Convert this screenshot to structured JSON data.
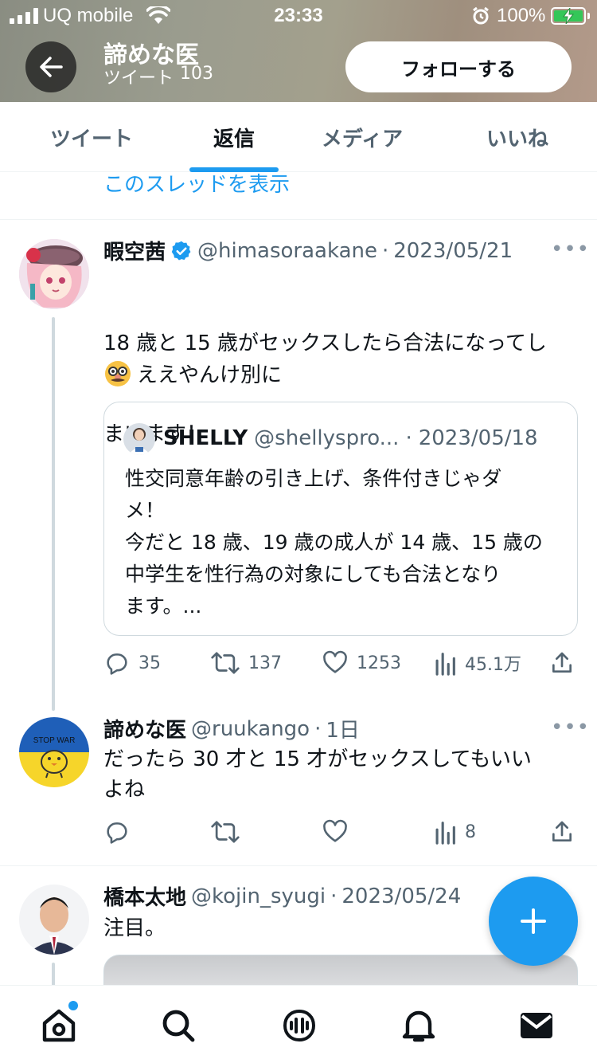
{
  "status_bar": {
    "carrier": "UQ mobile",
    "time": "23:33",
    "battery": "100%"
  },
  "header": {
    "profile_name": "諦めな医",
    "tweet_label": "ツイート",
    "tweet_count": "103",
    "follow_label": "フォローする"
  },
  "tabs": [
    {
      "label": "ツイート"
    },
    {
      "label": "返信"
    },
    {
      "label": "メディア"
    },
    {
      "label": "いいね"
    }
  ],
  "thread_link": "このスレッドを表示",
  "tweets": [
    {
      "name": "暇空茜",
      "verified": true,
      "handle": "@himasoraakane",
      "date": "2023/05/21",
      "text_line1": "18 歳と 15 歳がセックスしたら合法になってし",
      "text_line2": "まいます！",
      "text_line3": "ええやんけ別に",
      "quote": {
        "name": "SHELLY",
        "handle": "@shellyspro...",
        "date": "2023/05/18",
        "text": "性交同意年齢の引き上げ、条件付きじゃダ\nメ！\n今だと 18 歳、19 歳の成人が 14 歳、15 歳の\n中学生を性行為の対象にしても合法となり\nます。..."
      },
      "replies": "35",
      "retweets": "137",
      "likes": "1253",
      "views": "45.1万"
    },
    {
      "name": "諦めな医",
      "handle": "@ruukango",
      "date": "1日",
      "avatar_text": "STOP WAR",
      "text": "だったら 30 才と 15 才がセックスしてもいい\nよね",
      "views": "8"
    },
    {
      "name": "橋本太地",
      "handle": "@kojin_syugi",
      "date": "2023/05/24",
      "text": "注目。"
    }
  ],
  "icons": {
    "back": "arrow-left-icon",
    "verified": "verified-badge-icon",
    "reply": "reply-icon",
    "retweet": "retweet-icon",
    "like": "heart-icon",
    "views": "views-icon",
    "share": "share-icon",
    "compose": "plus-icon",
    "home": "home-icon",
    "search": "search-icon",
    "spaces": "spaces-icon",
    "notifications": "bell-icon",
    "messages": "mail-icon"
  },
  "colors": {
    "accent": "#1d9bf0",
    "text": "#0f1419",
    "secondary": "#536471"
  }
}
